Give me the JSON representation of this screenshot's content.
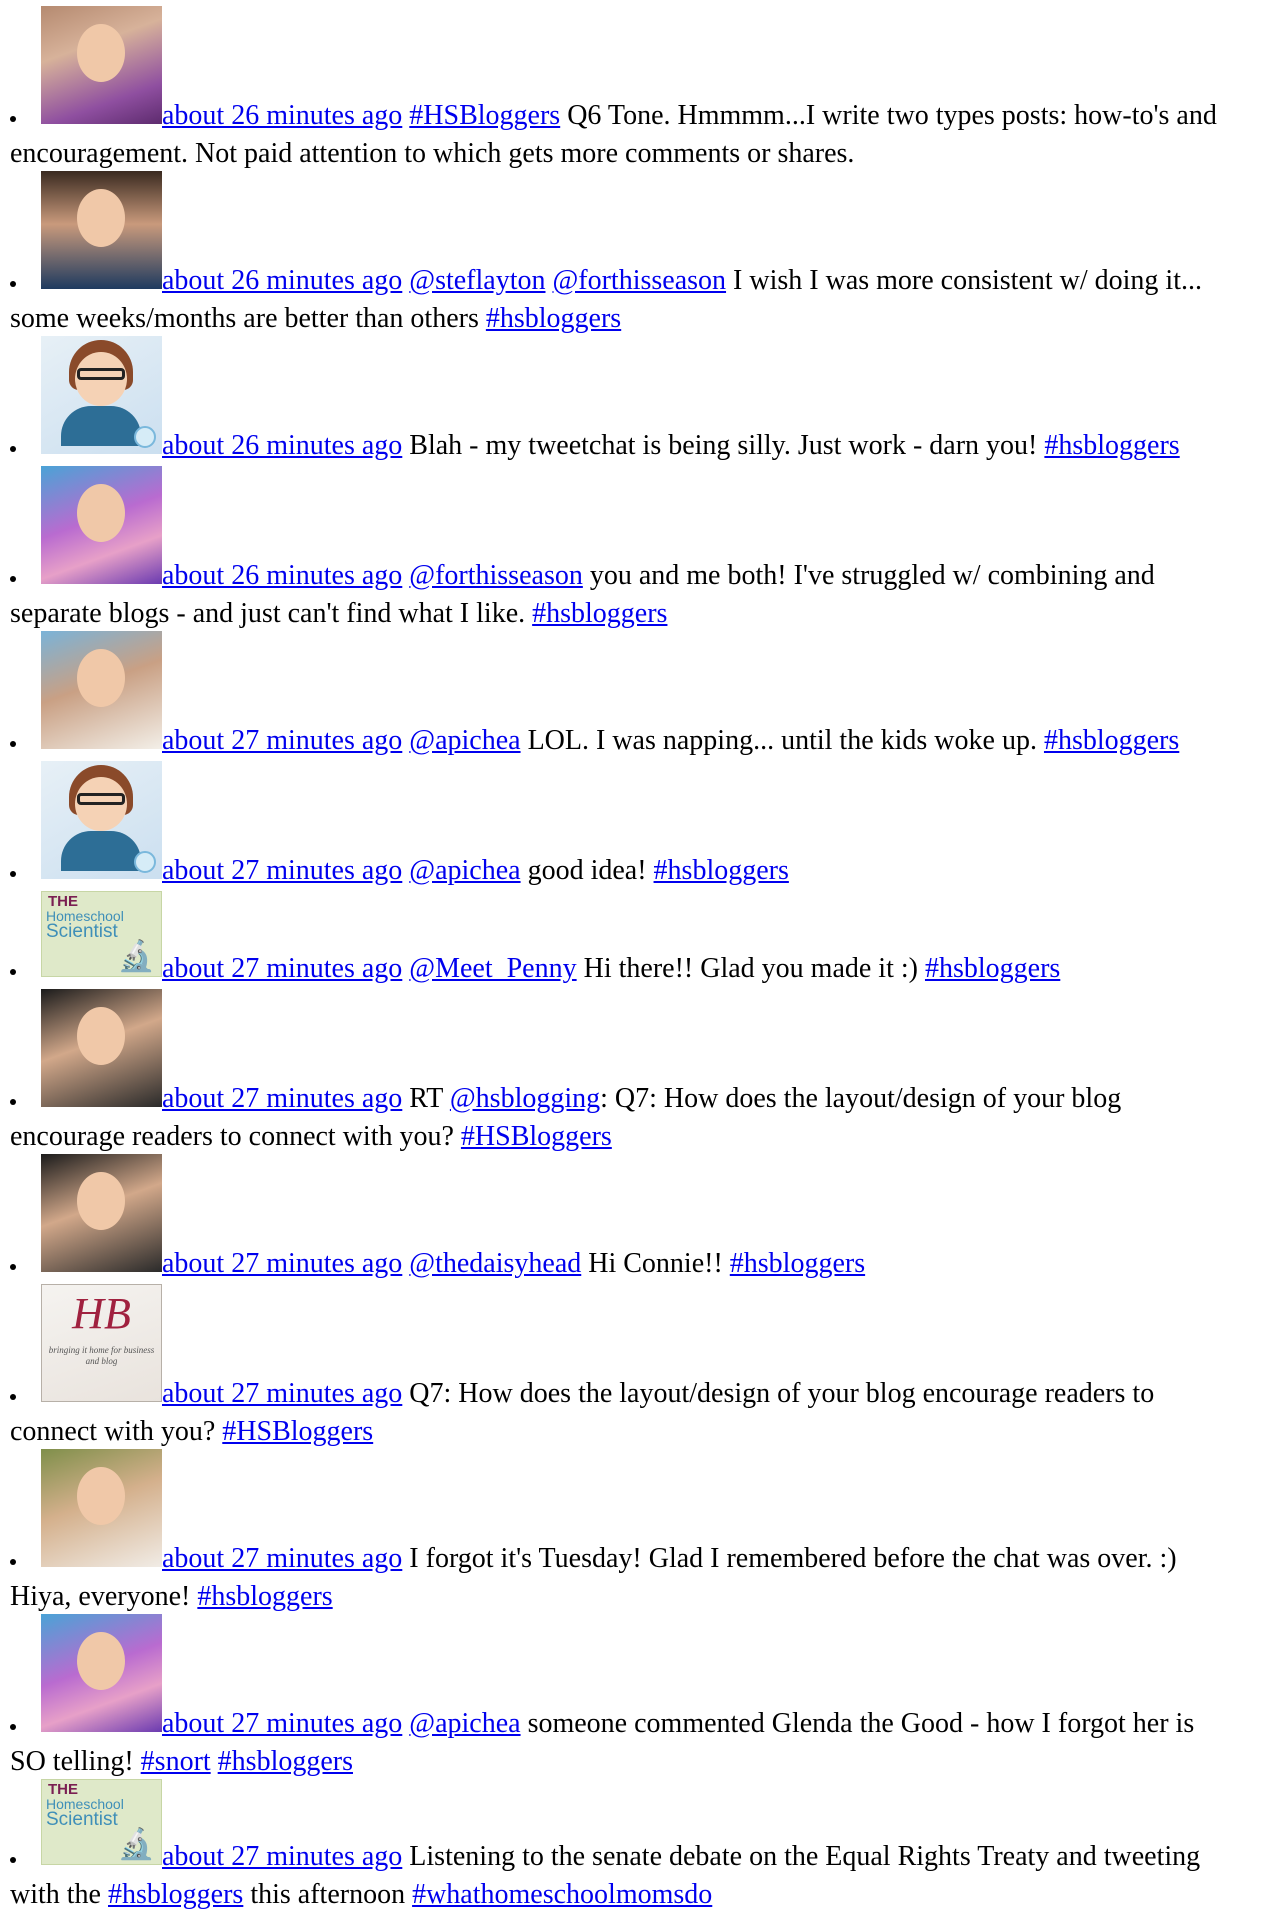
{
  "feed": [
    {
      "avatar": "photo-woman-purple-scarf",
      "time": "about 26 minutes ago",
      "parts": [
        {
          "type": "link",
          "text": "#HSBloggers"
        },
        {
          "type": "text",
          "text": " Q6 Tone. Hmmmm...I write two types posts: how-to's and encouragement. Not paid attention to which gets more comments or shares."
        }
      ]
    },
    {
      "avatar": "photo-woman-dark-hair",
      "time": "about 26 minutes ago",
      "parts": [
        {
          "type": "link",
          "text": "@steflayton"
        },
        {
          "type": "text",
          "text": " "
        },
        {
          "type": "link",
          "text": "@forthisseason"
        },
        {
          "type": "text",
          "text": " I wish I was more consistent w/ doing it... some weeks/months are better than others "
        },
        {
          "type": "link",
          "text": "#hsbloggers"
        }
      ]
    },
    {
      "avatar": "cartoon-woman-glasses",
      "time": "about 26 minutes ago",
      "parts": [
        {
          "type": "text",
          "text": " Blah - my tweetchat is being silly. Just work - darn you! "
        },
        {
          "type": "link",
          "text": "#hsbloggers"
        }
      ]
    },
    {
      "avatar": "photo-woman-pink-hair",
      "time": "about 26 minutes ago",
      "parts": [
        {
          "type": "link",
          "text": "@forthisseason"
        },
        {
          "type": "text",
          "text": " you and me both! I've struggled w/ combining and separate blogs - and just can't find what I like. "
        },
        {
          "type": "link",
          "text": "#hsbloggers"
        }
      ]
    },
    {
      "avatar": "photo-woman-smiling",
      "time": "about 27 minutes ago",
      "parts": [
        {
          "type": "link",
          "text": "@apichea"
        },
        {
          "type": "text",
          "text": " LOL. I was napping... until the kids woke up. "
        },
        {
          "type": "link",
          "text": "#hsbloggers"
        }
      ]
    },
    {
      "avatar": "cartoon-woman-glasses",
      "time": "about 27 minutes ago",
      "parts": [
        {
          "type": "link",
          "text": "@apichea"
        },
        {
          "type": "text",
          "text": " good idea! "
        },
        {
          "type": "link",
          "text": "#hsbloggers"
        }
      ]
    },
    {
      "avatar": "homeschool-scientist-logo",
      "time": "about 27 minutes ago",
      "parts": [
        {
          "type": "link",
          "text": "@Meet_Penny"
        },
        {
          "type": "text",
          "text": " Hi there!! Glad you made it :) "
        },
        {
          "type": "link",
          "text": "#hsbloggers"
        }
      ]
    },
    {
      "avatar": "photo-woman-bangs",
      "time": "about 27 minutes ago",
      "parts": [
        {
          "type": "text",
          "text": " RT "
        },
        {
          "type": "link",
          "text": "@hsblogging"
        },
        {
          "type": "text",
          "text": ": Q7: How does the layout/design of your blog encourage readers to connect with you? "
        },
        {
          "type": "link",
          "text": "#HSBloggers"
        }
      ]
    },
    {
      "avatar": "photo-woman-bangs",
      "time": "about 27 minutes ago",
      "parts": [
        {
          "type": "link",
          "text": "@thedaisyhead"
        },
        {
          "type": "text",
          "text": " Hi Connie!! "
        },
        {
          "type": "link",
          "text": "#hsbloggers"
        }
      ]
    },
    {
      "avatar": "hb-logo",
      "time": "about 27 minutes ago",
      "parts": [
        {
          "type": "text",
          "text": " Q7: How does the layout/design of your blog encourage readers to connect with you? "
        },
        {
          "type": "link",
          "text": "#HSBloggers"
        }
      ]
    },
    {
      "avatar": "photo-woman-glasses-green",
      "time": "about 27 minutes ago",
      "parts": [
        {
          "type": "text",
          "text": " I forgot it's Tuesday! Glad I remembered before the chat was over. :) Hiya, everyone! "
        },
        {
          "type": "link",
          "text": "#hsbloggers"
        }
      ]
    },
    {
      "avatar": "photo-woman-pink-hair",
      "time": "about 27 minutes ago",
      "parts": [
        {
          "type": "link",
          "text": "@apichea"
        },
        {
          "type": "text",
          "text": " someone commented Glenda the Good - how I forgot her is SO telling! "
        },
        {
          "type": "link",
          "text": "#snort"
        },
        {
          "type": "text",
          "text": " "
        },
        {
          "type": "link",
          "text": "#hsbloggers"
        }
      ]
    },
    {
      "avatar": "homeschool-scientist-logo",
      "time": "about 27 minutes ago",
      "parts": [
        {
          "type": "text",
          "text": " Listening to the senate debate on the Equal Rights Treaty and tweeting with the "
        },
        {
          "type": "link",
          "text": "#hsbloggers"
        },
        {
          "type": "text",
          "text": " this afternoon "
        },
        {
          "type": "link",
          "text": "#whathomeschoolmomsdo"
        }
      ]
    }
  ],
  "logos": {
    "homeschool_scientist": {
      "line1": "THE",
      "line2": "Homeschool",
      "line3": "Scientist"
    },
    "hb": {
      "monogram": "HB",
      "tagline": "bringing it home for business and blog"
    }
  }
}
